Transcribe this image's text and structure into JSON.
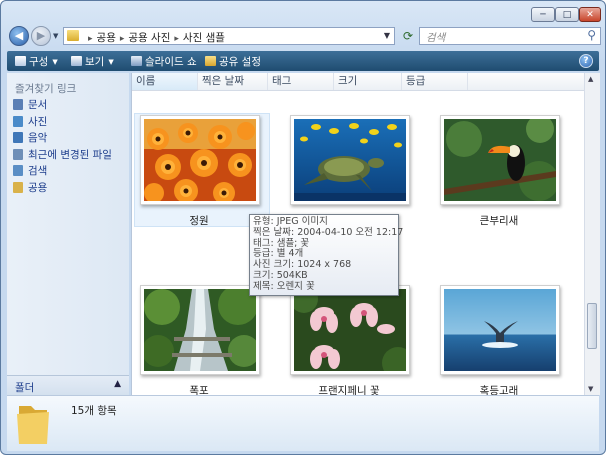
{
  "window": {
    "min": "─",
    "max": "□",
    "close": "✕"
  },
  "nav": {
    "breadcrumbs": [
      "공용",
      "공용 사진",
      "사진 샘플"
    ],
    "search_placeholder": "검색"
  },
  "toolbar": {
    "organize": "구성",
    "views": "보기",
    "slideshow": "슬라이드 쇼",
    "share": "공유 설정"
  },
  "sidebar": {
    "title": "즐겨찾기 링크",
    "items": [
      {
        "label": "문서",
        "icon": "documents-icon",
        "color": "#5a7fb5"
      },
      {
        "label": "사진",
        "icon": "pictures-icon",
        "color": "#4a8bc9"
      },
      {
        "label": "음악",
        "icon": "music-icon",
        "color": "#3f77b8"
      },
      {
        "label": "최근에 변경된 파일",
        "icon": "recent-icon",
        "color": "#6e8fb8"
      },
      {
        "label": "검색",
        "icon": "search-icon",
        "color": "#5a8ec5"
      },
      {
        "label": "공용",
        "icon": "public-folder-icon",
        "color": "#d9b24a"
      }
    ],
    "folders_label": "폴더"
  },
  "columns": [
    "이름",
    "찍은 날짜",
    "태그",
    "크기",
    "등급"
  ],
  "tiles": [
    {
      "caption": "정원",
      "image": "orange-flowers"
    },
    {
      "caption": "",
      "image": "sea-turtle"
    },
    {
      "caption": "큰부리새",
      "image": "toucan"
    },
    {
      "caption": "폭포",
      "image": "waterfall"
    },
    {
      "caption": "프랜지페니 꽃",
      "image": "frangipani"
    },
    {
      "caption": "혹등고래",
      "image": "humpback-whale"
    }
  ],
  "tooltip": [
    "유형: JPEG 이미지",
    "찍은 날짜: 2004-04-10 오전 12:17",
    "태그: 샘플; 꽃",
    "등급: 별 4개",
    "사진 크기: 1024 x 768",
    "크기: 504KB",
    "제목: 오렌지 꽃"
  ],
  "status": {
    "count": "15개 항목"
  }
}
